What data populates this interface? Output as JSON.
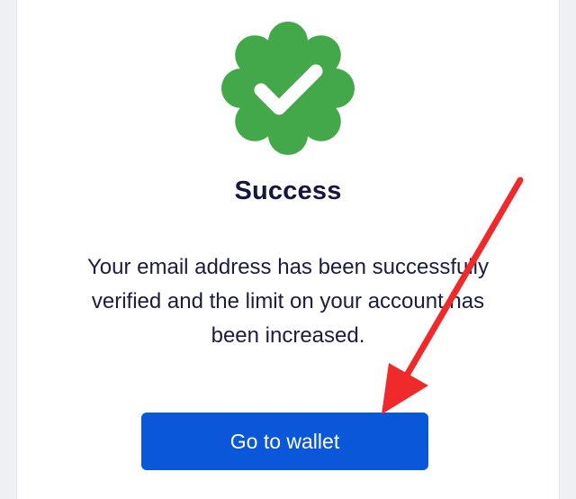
{
  "dialog": {
    "icon": "verified-check-badge-icon",
    "title": "Success",
    "message": "Your email address has been successfully verified and the limit on your account has been increased.",
    "button_label": "Go to wallet"
  },
  "annotation": {
    "icon": "red-arrow-icon",
    "color": "#f02a2a"
  },
  "colors": {
    "badge": "#43a84a",
    "button": "#0a57d9",
    "title": "#16173f"
  }
}
